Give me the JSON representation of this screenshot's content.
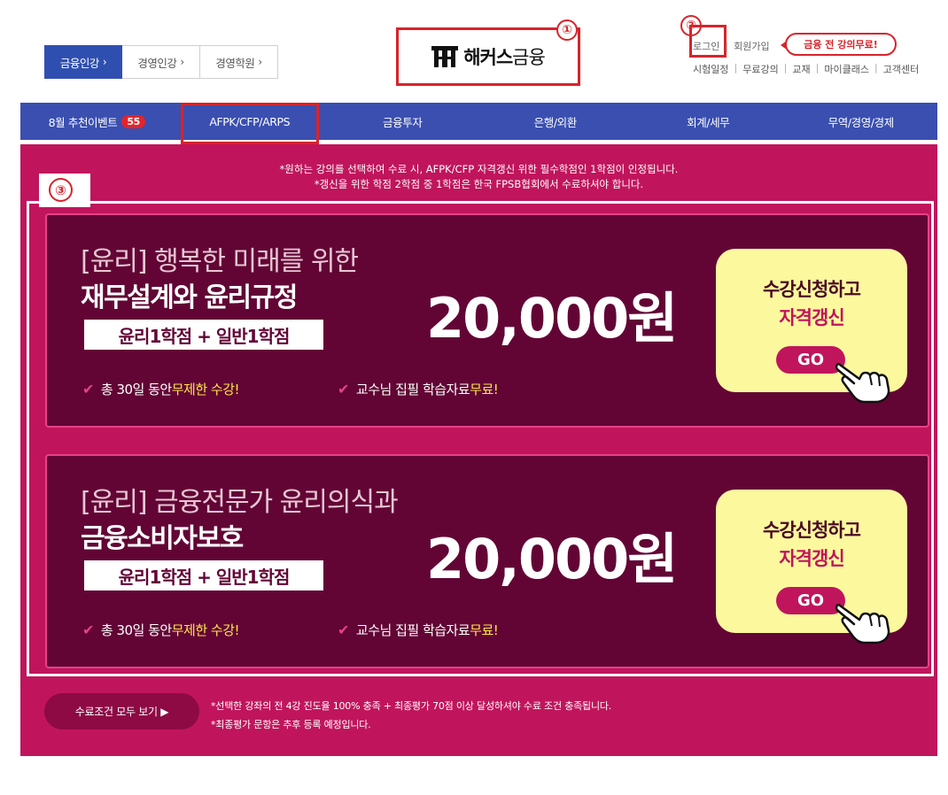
{
  "header": {
    "tabs": [
      {
        "label": "금융인강",
        "arrow": "›"
      },
      {
        "label": "경영인강",
        "arrow": "›"
      },
      {
        "label": "경영학원",
        "arrow": "›"
      }
    ],
    "logo": {
      "brand": "해커스",
      "suffix": "금융"
    },
    "util_top": {
      "login": "로그인",
      "signup": "회원가입",
      "free_badge": "금융 전 강의무료!"
    },
    "util_links": [
      "시험일정",
      "무료강의",
      "교재",
      "마이클래스",
      "고객센터"
    ],
    "separator": "|"
  },
  "annotations": {
    "one": "①",
    "two": "②",
    "three": "③"
  },
  "nav": {
    "items": [
      {
        "label": "8월 추천이벤트",
        "count": "55"
      },
      {
        "label": "AFPK/CFP/ARPS"
      },
      {
        "label": "금융투자"
      },
      {
        "label": "은행/외환"
      },
      {
        "label": "회계/세무"
      },
      {
        "label": "무역/경영/경제"
      }
    ]
  },
  "promo": {
    "notice": [
      "*원하는 강의를 선택하여 수료 시, AFPK/CFP 자격갱신 위한 필수학점인 1학점이 인정됩니다.",
      "*갱신을 위한 학점 2학점 중 1학점은 한국 FPSB협회에서 수료하셔야 합니다."
    ],
    "cards": [
      {
        "subtitle": "[윤리] 행복한 미래를 위한",
        "title": "재무설계와 윤리규정",
        "credit": "윤리1학점 + 일반1학점",
        "price": "20,000원",
        "feature_a_pre": "총 30일 동안 ",
        "feature_a_hl": "무제한 수강!",
        "feature_b_pre": "교수님 집필 학습자료 ",
        "feature_b_hl": "무료!",
        "cta_line1": "수강신청하고",
        "cta_line2": "자격갱신",
        "cta_go": "GO"
      },
      {
        "subtitle": "[윤리] 금융전문가 윤리의식과",
        "title": "금융소비자보호",
        "credit": "윤리1학점 + 일반1학점",
        "price": "20,000원",
        "feature_a_pre": "총 30일 동안 ",
        "feature_a_hl": "무제한 수강!",
        "feature_b_pre": "교수님 집필 학습자료 ",
        "feature_b_hl": "무료!",
        "cta_line1": "수강신청하고",
        "cta_line2": "자격갱신",
        "cta_go": "GO"
      }
    ],
    "check_glyph": "✔",
    "more_button": "수료조건 모두 보기 ▶",
    "footnotes": [
      "*선택한 강좌의 전 4강 진도율 100% 충족 + 최종평가 70점 이상 달성하셔야 수료 조건 충족됩니다.",
      "*최종평가 문항은 추후 등록 예정입니다."
    ]
  },
  "colors": {
    "nav_blue": "#3a4fb0",
    "promo_pink": "#c0155c",
    "card_plum": "#620535",
    "highlight_yellow": "#ffe44d",
    "cta_yellow": "#fbf89e",
    "annotation_red": "#d8232a"
  }
}
